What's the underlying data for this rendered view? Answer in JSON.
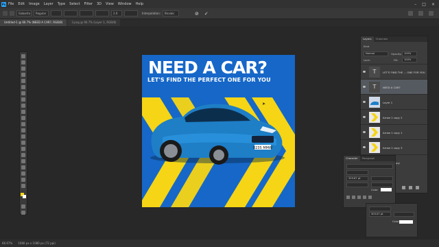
{
  "menu": {
    "app_icon": "photoshop-logo",
    "items": [
      "File",
      "Edit",
      "Image",
      "Layer",
      "Type",
      "Select",
      "Filter",
      "3D",
      "View",
      "Window",
      "Help"
    ]
  },
  "options": {
    "font_name": "Gabarito",
    "font_style": "Regular",
    "leading": "2.0",
    "antialias_label": "Interpolation:",
    "antialias_value": "Bicubic"
  },
  "tabs": [
    {
      "label": "Untitled-1 @ 66.7% (NEED A CAR?, RGB/8)",
      "active": true
    },
    {
      "label": "3.png @ 66.7% (Layer 1, RGB/8)",
      "active": false
    }
  ],
  "canvas": {
    "headline": "NEED A CAR?",
    "subheadline": "LET'S FIND THE PERFECT ONE FOR YOU",
    "plate": "0235 MMW",
    "bg_color": "#1667c8",
    "stripe_color": "#f5d515"
  },
  "layers": {
    "tabs": [
      "Layers",
      "Channels"
    ],
    "kind_label": "Kind",
    "blend_mode": "Normal",
    "opacity_label": "Opacity:",
    "opacity_value": "100%",
    "lock_label": "Lock:",
    "fill_label": "Fill:",
    "fill_value": "100%",
    "items": [
      {
        "name": "LET'S FIND THE ... ONE FOR YOU",
        "type": "text",
        "selected": false
      },
      {
        "name": "NEED A CAR?",
        "type": "text",
        "selected": true
      },
      {
        "name": "Layer 1",
        "type": "image",
        "selected": false
      },
      {
        "name": "Arrow 1 copy 2",
        "type": "arrow",
        "selected": false
      },
      {
        "name": "Arrow 1 copy 1",
        "type": "arrow",
        "selected": false
      },
      {
        "name": "Arrow 1 copy 3",
        "type": "arrow",
        "selected": false
      },
      {
        "name": "Arrow 1 copy",
        "type": "arrow",
        "selected": false
      }
    ]
  },
  "character": {
    "tabs": [
      "Character",
      "Paragraph"
    ],
    "size": "329.67 pt",
    "color_label": "Color:",
    "size2": "303.07 pt"
  },
  "status": {
    "zoom": "66.67%",
    "doc": "1080 px x 1080 px (72 ppi)"
  }
}
